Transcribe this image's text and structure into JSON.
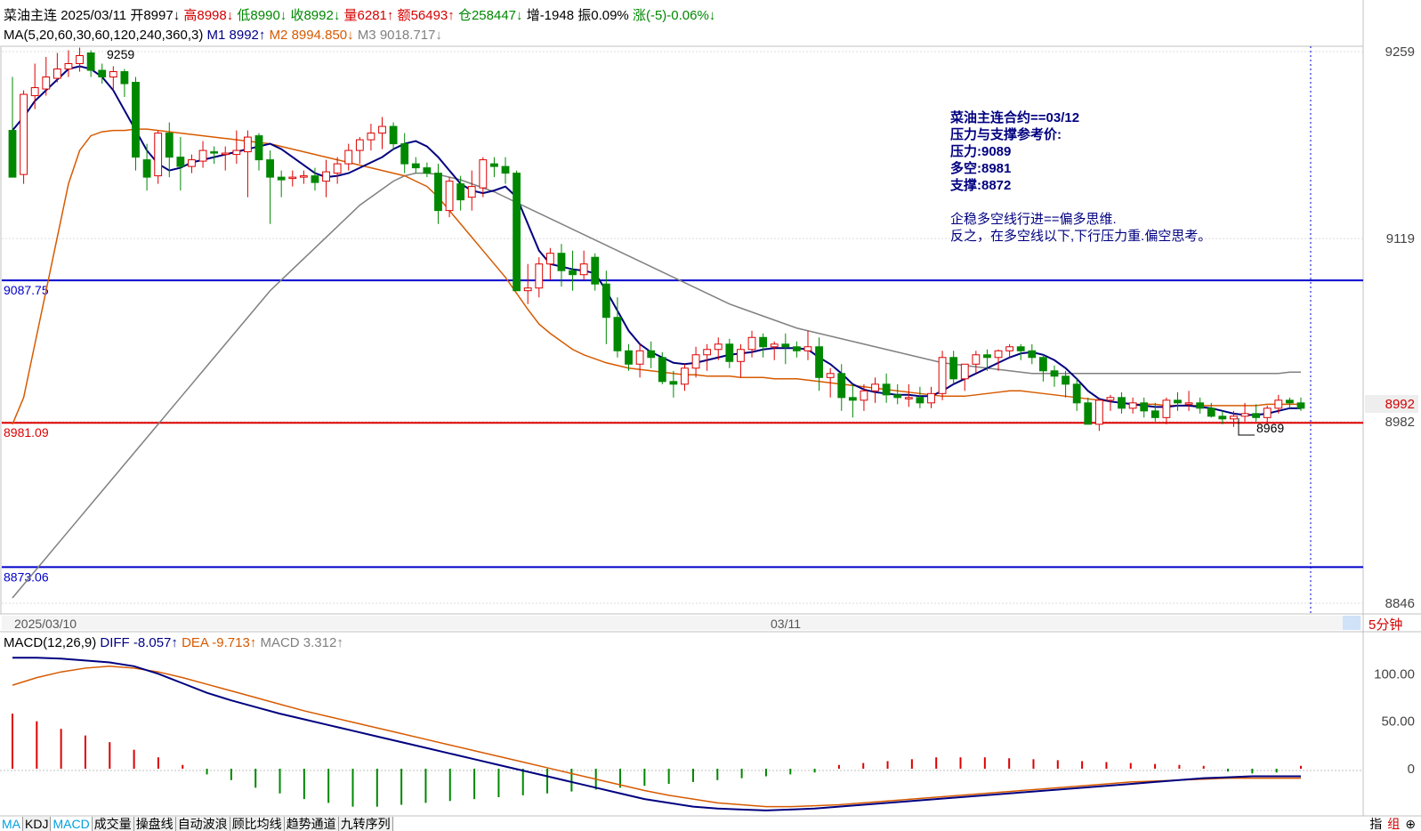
{
  "header": {
    "name": "菜油主连",
    "date": "2025/03/11",
    "open": "开8997↓",
    "high": "高8998↓",
    "low": "低8990↓",
    "close": "收8992↓",
    "volume": "量6281↑",
    "amount": "额56493↑",
    "oi": "仓258447↓",
    "oi_change": "增-1948",
    "amplitude": "振0.09%",
    "change": "涨(-5)-0.06%↓"
  },
  "ma_line": {
    "label": "MA(5,20,60,30,60,120,240,360,3)",
    "m1": "M1 8992↑",
    "m2": "M2 8994.850↓",
    "m3": "M3 9018.717↓"
  },
  "macd_header": {
    "label": "MACD(12,26,9)",
    "diff": "DIFF -8.057↑",
    "dea": "DEA -9.713↑",
    "macd": "MACD 3.312↑"
  },
  "annotation": {
    "line1": "菜油主连合约==03/12",
    "line2": "压力与支撑参考价:",
    "line3": "压力:9089",
    "line4": "多空:8981",
    "line5": "支撑:8872",
    "line6": "企稳多空线行进==偏多思维.",
    "line7": "反之，在多空线以下,下行压力重.偏空思考。"
  },
  "hlines": [
    {
      "label": "9087.75",
      "value": 9087.75,
      "color": "#0000cc"
    },
    {
      "label": "8981.09",
      "value": 8981.09,
      "color": "#dd0000"
    },
    {
      "label": "8873.06",
      "value": 8873.06,
      "color": "#0000cc"
    }
  ],
  "price_ticks": [
    "9259",
    "9119",
    "8982",
    "8846"
  ],
  "current_price": "8992",
  "marks": {
    "high": "9259",
    "low": "8969"
  },
  "date_labels": [
    "2025/03/10",
    "03/11"
  ],
  "period": "5分钟",
  "macd_ticks": [
    "100.00",
    "50.00",
    "0"
  ],
  "tabs": [
    "MA",
    "KDJ",
    "MACD",
    "成交量",
    "操盘线",
    "自动波浪",
    "顾比均线",
    "趋势通道",
    "九转序列"
  ],
  "bottom_right": [
    "指",
    "组"
  ],
  "colors": {
    "up": "#dd0000",
    "down": "#008800",
    "ma1": "#000080",
    "ma2": "#d75a00",
    "ma3": "#808080"
  },
  "chart_data": {
    "type": "candlestick",
    "ylim": [
      8846,
      9259
    ],
    "candles": [
      [
        9200,
        9240,
        9170,
        9165
      ],
      [
        9167,
        9230,
        9160,
        9227
      ],
      [
        9226,
        9250,
        9216,
        9232
      ],
      [
        9231,
        9255,
        9226,
        9240
      ],
      [
        9239,
        9258,
        9236,
        9246
      ],
      [
        9246,
        9260,
        9240,
        9250
      ],
      [
        9250,
        9262,
        9244,
        9256
      ],
      [
        9258,
        9260,
        9240,
        9245
      ],
      [
        9245,
        9250,
        9235,
        9240
      ],
      [
        9240,
        9248,
        9230,
        9244
      ],
      [
        9244,
        9246,
        9225,
        9235
      ],
      [
        9236,
        9240,
        9170,
        9180
      ],
      [
        9178,
        9190,
        9155,
        9165
      ],
      [
        9166,
        9200,
        9160,
        9198
      ],
      [
        9198,
        9206,
        9165,
        9180
      ],
      [
        9180,
        9195,
        9155,
        9173
      ],
      [
        9173,
        9182,
        9168,
        9178
      ],
      [
        9177,
        9192,
        9172,
        9185
      ],
      [
        9184,
        9188,
        9175,
        9183
      ],
      [
        9183,
        9188,
        9170,
        9183
      ],
      [
        9182,
        9200,
        9175,
        9185
      ],
      [
        9184,
        9200,
        9150,
        9195
      ],
      [
        9196,
        9198,
        9170,
        9178
      ],
      [
        9178,
        9185,
        9130,
        9165
      ],
      [
        9165,
        9170,
        9150,
        9163
      ],
      [
        9164,
        9170,
        9158,
        9165
      ],
      [
        9165,
        9170,
        9160,
        9166
      ],
      [
        9166,
        9172,
        9155,
        9161
      ],
      [
        9162,
        9178,
        9150,
        9169
      ],
      [
        9168,
        9180,
        9160,
        9175
      ],
      [
        9175,
        9190,
        9170,
        9185
      ],
      [
        9185,
        9195,
        9175,
        9193
      ],
      [
        9193,
        9205,
        9185,
        9198
      ],
      [
        9198,
        9210,
        9186,
        9203
      ],
      [
        9203,
        9206,
        9185,
        9190
      ],
      [
        9190,
        9198,
        9168,
        9175
      ],
      [
        9175,
        9180,
        9168,
        9172
      ],
      [
        9172,
        9176,
        9165,
        9168
      ],
      [
        9168,
        9175,
        9130,
        9140
      ],
      [
        9140,
        9165,
        9135,
        9162
      ],
      [
        9160,
        9166,
        9140,
        9148
      ],
      [
        9150,
        9170,
        9140,
        9158
      ],
      [
        9157,
        9180,
        9150,
        9178
      ],
      [
        9175,
        9180,
        9165,
        9173
      ],
      [
        9173,
        9180,
        9160,
        9168
      ],
      [
        9168,
        9170,
        9080,
        9080
      ],
      [
        9080,
        9100,
        9070,
        9082
      ],
      [
        9082,
        9105,
        9075,
        9100
      ],
      [
        9100,
        9112,
        9088,
        9108
      ],
      [
        9108,
        9115,
        9083,
        9095
      ],
      [
        9095,
        9110,
        9080,
        9092
      ],
      [
        9092,
        9110,
        9088,
        9100
      ],
      [
        9105,
        9108,
        9080,
        9085
      ],
      [
        9085,
        9095,
        9040,
        9060
      ],
      [
        9060,
        9075,
        9030,
        9035
      ],
      [
        9035,
        9040,
        9020,
        9025
      ],
      [
        9025,
        9040,
        9015,
        9035
      ],
      [
        9035,
        9042,
        9022,
        9030
      ],
      [
        9030,
        9034,
        9010,
        9012
      ],
      [
        9012,
        9020,
        9000,
        9010
      ],
      [
        9010,
        9025,
        9005,
        9022
      ],
      [
        9022,
        9038,
        9015,
        9032
      ],
      [
        9032,
        9040,
        9020,
        9036
      ],
      [
        9036,
        9045,
        9028,
        9040
      ],
      [
        9040,
        9044,
        9022,
        9027
      ],
      [
        9027,
        9040,
        9015,
        9036
      ],
      [
        9036,
        9050,
        9030,
        9045
      ],
      [
        9045,
        9048,
        9030,
        9038
      ],
      [
        9038,
        9042,
        9028,
        9040
      ],
      [
        9040,
        9048,
        9025,
        9038
      ],
      [
        9038,
        9042,
        9030,
        9035
      ],
      [
        9035,
        9050,
        9028,
        9038
      ],
      [
        9038,
        9045,
        9005,
        9015
      ],
      [
        9015,
        9022,
        9000,
        9018
      ],
      [
        9018,
        9025,
        8990,
        9000
      ],
      [
        9000,
        9010,
        8985,
        8998
      ],
      [
        8998,
        9010,
        8990,
        9005
      ],
      [
        9005,
        9015,
        8996,
        9010
      ],
      [
        9010,
        9018,
        8996,
        9002
      ],
      [
        9002,
        9010,
        8995,
        9000
      ],
      [
        9000,
        9010,
        8993,
        9000
      ],
      [
        9000,
        9008,
        8992,
        8996
      ],
      [
        8996,
        9008,
        8992,
        9003
      ],
      [
        9003,
        9035,
        8998,
        9030
      ],
      [
        9030,
        9035,
        9010,
        9014
      ],
      [
        9014,
        9025,
        9005,
        9025
      ],
      [
        9025,
        9035,
        9018,
        9032
      ],
      [
        9032,
        9036,
        9020,
        9030
      ],
      [
        9030,
        9036,
        9020,
        9035
      ],
      [
        9035,
        9040,
        9030,
        9038
      ],
      [
        9038,
        9040,
        9028,
        9035
      ],
      [
        9035,
        9040,
        9025,
        9030
      ],
      [
        9030,
        9032,
        9012,
        9020
      ],
      [
        9020,
        9024,
        9008,
        9016
      ],
      [
        9016,
        9020,
        9000,
        9010
      ],
      [
        9010,
        9014,
        8990,
        8996
      ],
      [
        8996,
        9000,
        8980,
        8980
      ],
      [
        8980,
        9000,
        8975,
        8998
      ],
      [
        8998,
        9002,
        8990,
        9000
      ],
      [
        9000,
        9004,
        8988,
        8992
      ],
      [
        8992,
        9000,
        8988,
        8996
      ],
      [
        8996,
        9000,
        8985,
        8990
      ],
      [
        8990,
        8996,
        8982,
        8985
      ],
      [
        8985,
        9000,
        8980,
        8998
      ],
      [
        8998,
        9004,
        8990,
        8996
      ],
      [
        8996,
        9005,
        8990,
        8996
      ],
      [
        8996,
        9000,
        8988,
        8992
      ],
      [
        8992,
        8996,
        8985,
        8986
      ],
      [
        8986,
        8990,
        8980,
        8984
      ],
      [
        8984,
        8990,
        8978,
        8986
      ],
      [
        8986,
        8996,
        8982,
        8988
      ],
      [
        8988,
        8995,
        8982,
        8985
      ],
      [
        8985,
        8994,
        8980,
        8992
      ],
      [
        8992,
        9002,
        8988,
        8998
      ],
      [
        8998,
        9000,
        8992,
        8996
      ],
      [
        8996,
        9000,
        8990,
        8992
      ]
    ],
    "ma1": [
      9200,
      9210,
      9222,
      9230,
      9238,
      9246,
      9248,
      9246,
      9240,
      9230,
      9215,
      9200,
      9185,
      9175,
      9170,
      9172,
      9176,
      9178,
      9180,
      9182,
      9184,
      9186,
      9188,
      9190,
      9186,
      9180,
      9174,
      9168,
      9165,
      9166,
      9168,
      9172,
      9176,
      9180,
      9186,
      9190,
      9192,
      9188,
      9180,
      9170,
      9160,
      9155,
      9153,
      9155,
      9158,
      9150,
      9130,
      9110,
      9100,
      9098,
      9096,
      9095,
      9093,
      9080,
      9065,
      9050,
      9040,
      9034,
      9030,
      9026,
      9025,
      9026,
      9028,
      9030,
      9032,
      9033,
      9034,
      9036,
      9037,
      9037,
      9037,
      9036,
      9030,
      9025,
      9018,
      9010,
      9006,
      9004,
      9003,
      9002,
      9002,
      9001,
      9001,
      9005,
      9010,
      9014,
      9018,
      9022,
      9026,
      9030,
      9033,
      9034,
      9032,
      9028,
      9022,
      9014,
      9005,
      8999,
      8997,
      8996,
      8995,
      8994,
      8993,
      8993,
      8994,
      8994,
      8993,
      8992,
      8990,
      8988,
      8987,
      8987,
      8988,
      8990,
      8992,
      8992
    ],
    "ma2": [
      8980,
      9000,
      9040,
      9080,
      9120,
      9160,
      9185,
      9196,
      9199,
      9200,
      9200,
      9201,
      9201,
      9200,
      9199,
      9198,
      9197,
      9196,
      9195,
      9194,
      9193,
      9192,
      9191,
      9190,
      9188,
      9186,
      9184,
      9182,
      9180,
      9178,
      9176,
      9174,
      9172,
      9170,
      9168,
      9166,
      9162,
      9158,
      9150,
      9140,
      9130,
      9120,
      9110,
      9100,
      9090,
      9078,
      9066,
      9055,
      9048,
      9042,
      9036,
      9032,
      9029,
      9026,
      9024,
      9022,
      9021,
      9020,
      9019,
      9018,
      9017,
      9017,
      9016,
      9016,
      9016,
      9015,
      9015,
      9015,
      9014,
      9014,
      9014,
      9013,
      9012,
      9011,
      9010,
      9009,
      9008,
      9007,
      9006,
      9005,
      9004,
      9003,
      9002,
      9001,
      9001,
      9001,
      9002,
      9003,
      9004,
      9005,
      9005,
      9004,
      9003,
      9002,
      9001,
      9000,
      8999,
      8998,
      8997,
      8996,
      8995,
      8995,
      8995,
      8994,
      8994,
      8994,
      8994,
      8994,
      8994,
      8994,
      8994,
      8994,
      8995,
      8995,
      8995,
      8995
    ],
    "ma3": [
      8850,
      8860,
      8870,
      8880,
      8890,
      8900,
      8910,
      8920,
      8930,
      8940,
      8950,
      8960,
      8970,
      8980,
      8990,
      9000,
      9010,
      9020,
      9030,
      9040,
      9050,
      9060,
      9070,
      9080,
      9088,
      9096,
      9104,
      9112,
      9120,
      9128,
      9136,
      9144,
      9150,
      9156,
      9162,
      9166,
      9168,
      9168,
      9167,
      9165,
      9163,
      9160,
      9157,
      9154,
      9150,
      9146,
      9142,
      9138,
      9134,
      9130,
      9126,
      9122,
      9118,
      9114,
      9110,
      9106,
      9102,
      9098,
      9094,
      9090,
      9086,
      9082,
      9078,
      9074,
      9070,
      9067,
      9064,
      9061,
      9058,
      9055,
      9052,
      9050,
      9048,
      9046,
      9044,
      9042,
      9040,
      9038,
      9036,
      9034,
      9032,
      9030,
      9028,
      9026,
      9025,
      9024,
      9023,
      9022,
      9021,
      9020,
      9019,
      9018,
      9018,
      9018,
      9018,
      9018,
      9018,
      9018,
      9018,
      9018,
      9018,
      9018,
      9018,
      9018,
      9018,
      9018,
      9018,
      9018,
      9018,
      9018,
      9018,
      9018,
      9018,
      9018,
      9019,
      9019
    ],
    "macd": {
      "ylim": [
        -45,
        135
      ],
      "diff": [
        117,
        117,
        116,
        114,
        112,
        108,
        100,
        90,
        80,
        72,
        65,
        58,
        52,
        46,
        40,
        34,
        28,
        22,
        16,
        10,
        4,
        -2,
        -8,
        -14,
        -20,
        -26,
        -32,
        -36,
        -40,
        -42,
        -43,
        -44,
        -43,
        -42,
        -40,
        -38,
        -36,
        -34,
        -32,
        -30,
        -28,
        -26,
        -24,
        -22,
        -20,
        -18,
        -16,
        -14,
        -12,
        -10,
        -9,
        -8,
        -8,
        -8
      ],
      "dea": [
        88,
        96,
        102,
        106,
        108,
        106,
        102,
        96,
        89,
        82,
        75,
        68,
        61,
        55,
        49,
        43,
        37,
        31,
        25,
        19,
        13,
        7,
        1,
        -5,
        -11,
        -17,
        -23,
        -28,
        -32,
        -36,
        -38,
        -40,
        -40,
        -39,
        -38,
        -36,
        -34,
        -32,
        -30,
        -28,
        -26,
        -24,
        -22,
        -20,
        -18,
        -16,
        -14,
        -13,
        -12,
        -11,
        -10,
        -10,
        -10,
        -10
      ],
      "hist": [
        58,
        50,
        42,
        35,
        28,
        20,
        12,
        4,
        -6,
        -12,
        -20,
        -26,
        -32,
        -36,
        -40,
        -40,
        -38,
        -36,
        -34,
        -32,
        -30,
        -28,
        -26,
        -24,
        -22,
        -20,
        -18,
        -16,
        -14,
        -12,
        -10,
        -8,
        -6,
        -4,
        4,
        6,
        8,
        10,
        12,
        12,
        12,
        11,
        10,
        9,
        8,
        7,
        6,
        5,
        4,
        3,
        -3,
        -5,
        -4,
        3
      ]
    }
  }
}
